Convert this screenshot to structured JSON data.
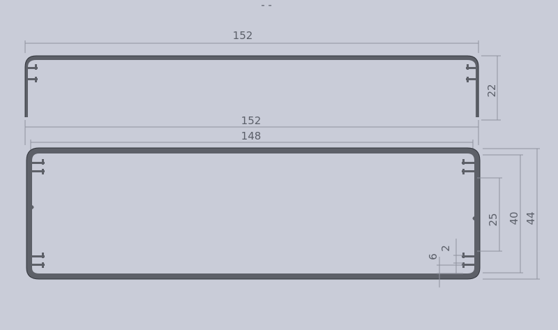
{
  "colors": {
    "background": "#c9ccd8",
    "profile": "#5d6068",
    "dimension_line": "#8e929e",
    "dimension_text": "#5b5f69"
  },
  "top_profile": {
    "width_label": "152",
    "height_label": "22"
  },
  "bottom_profile": {
    "outer_width_label": "152",
    "inner_width_label": "148",
    "height_44_label": "44",
    "height_40_label": "40",
    "height_25_label": "25",
    "slot_2_label": "2",
    "slot_6_label": "6"
  },
  "top_mark": "- -"
}
